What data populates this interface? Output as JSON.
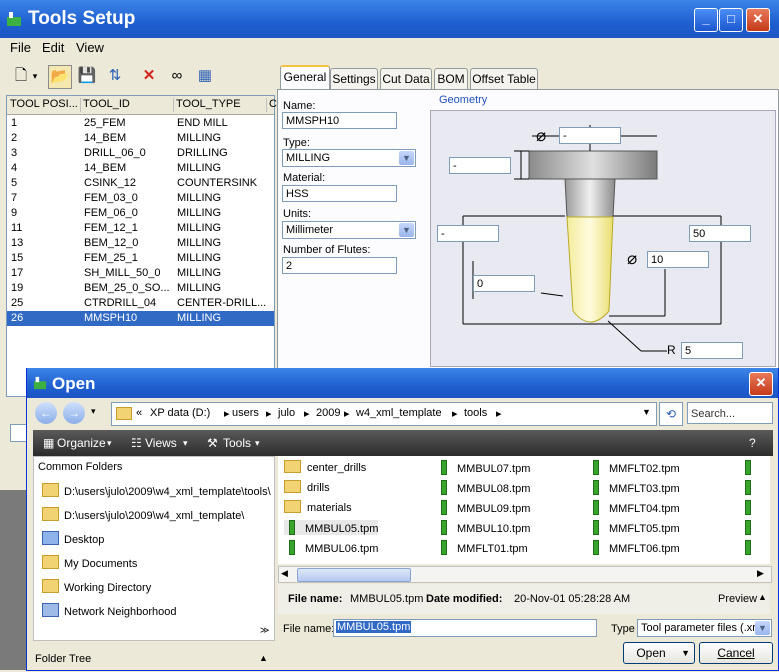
{
  "tools_window": {
    "title": "Tools Setup",
    "menu": [
      "File",
      "Edit",
      "View"
    ],
    "list_columns": [
      "TOOL POSI...",
      "TOOL_ID",
      "TOOL_TYPE",
      "C"
    ],
    "rows": [
      {
        "pos": "1",
        "id": "25_FEM",
        "type": "END MILL"
      },
      {
        "pos": "2",
        "id": "14_BEM",
        "type": "MILLING"
      },
      {
        "pos": "3",
        "id": "DRILL_06_0",
        "type": "DRILLING"
      },
      {
        "pos": "4",
        "id": "14_BEM",
        "type": "MILLING"
      },
      {
        "pos": "5",
        "id": "CSINK_12",
        "type": "COUNTERSINK"
      },
      {
        "pos": "7",
        "id": "FEM_03_0",
        "type": "MILLING"
      },
      {
        "pos": "9",
        "id": "FEM_06_0",
        "type": "MILLING"
      },
      {
        "pos": "11",
        "id": "FEM_12_1",
        "type": "MILLING"
      },
      {
        "pos": "13",
        "id": "BEM_12_0",
        "type": "MILLING"
      },
      {
        "pos": "15",
        "id": "FEM_25_1",
        "type": "MILLING"
      },
      {
        "pos": "17",
        "id": "SH_MILL_50_0",
        "type": "MILLING"
      },
      {
        "pos": "19",
        "id": "BEM_25_0_SO...",
        "type": "MILLING"
      },
      {
        "pos": "25",
        "id": "CTRDRILL_04",
        "type": "CENTER-DRILL..."
      },
      {
        "pos": "26",
        "id": "MMSPH10",
        "type": "MILLING"
      }
    ],
    "tabs": [
      "General",
      "Settings",
      "Cut Data",
      "BOM",
      "Offset Table"
    ],
    "general": {
      "name_label": "Name:",
      "name_value": "MMSPH10",
      "type_label": "Type:",
      "type_value": "MILLING",
      "material_label": "Material:",
      "material_value": "HSS",
      "units_label": "Units:",
      "units_value": "Millimeter",
      "flutes_label": "Number of Flutes:",
      "flutes_value": "2"
    },
    "geometry": {
      "group_label": "Geometry",
      "diameter_top": "-",
      "height_top": "-",
      "length_left": "-",
      "length_right": "50",
      "corner": "0",
      "diameter": "10",
      "radius_label": "R",
      "radius": "5",
      "diameter_symbol": "⌀"
    }
  },
  "open_dialog": {
    "title": "Open",
    "path": [
      "«",
      "XP data (D:)",
      "users",
      "julo",
      "2009",
      "w4_xml_template",
      "tools"
    ],
    "search_placeholder": "Search...",
    "commands": [
      "Organize",
      "Views",
      "Tools"
    ],
    "common_folders_label": "Common Folders",
    "left_items": [
      "D:\\users\\julo\\2009\\w4_xml_template\\tools\\",
      "D:\\users\\julo\\2009\\w4_xml_template\\",
      "Desktop",
      "My Documents",
      "Working Directory",
      "Network Neighborhood"
    ],
    "folder_tree_label": "Folder Tree",
    "files_col1": [
      {
        "name": "center_drills",
        "kind": "folder"
      },
      {
        "name": "drills",
        "kind": "folder"
      },
      {
        "name": "materials",
        "kind": "folder"
      },
      {
        "name": "MMBUL05.tpm",
        "kind": "tpm"
      },
      {
        "name": "MMBUL06.tpm",
        "kind": "tpm"
      }
    ],
    "files_col2": [
      "MMBUL07.tpm",
      "MMBUL08.tpm",
      "MMBUL09.tpm",
      "MMBUL10.tpm",
      "MMFLT01.tpm"
    ],
    "files_col3": [
      "MMFLT02.tpm",
      "MMFLT03.tpm",
      "MMFLT04.tpm",
      "MMFLT05.tpm",
      "MMFLT06.tpm"
    ],
    "details": {
      "file_name_label": "File name:",
      "file_name": "MMBUL05.tpm",
      "date_label": "Date modified:",
      "date": "20-Nov-01 05:28:28 AM",
      "preview": "Preview"
    },
    "file_name_label": "File name:",
    "file_name_value": "MMBUL05.tpm",
    "type_label": "Type",
    "type_value": "Tool parameter files (.xr",
    "open_label": "Open",
    "cancel_label": "Cancel"
  }
}
